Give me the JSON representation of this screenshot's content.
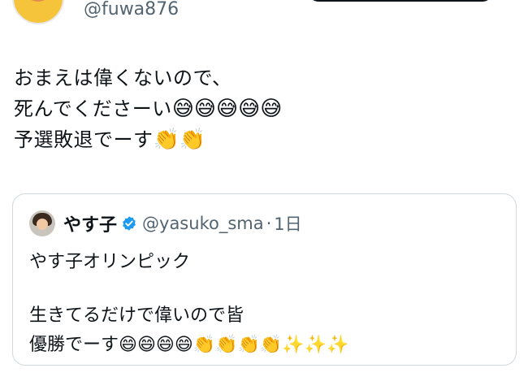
{
  "author": {
    "handle": "@fuwa876",
    "avatar_icon": "avatar-image"
  },
  "tweet": {
    "lines": [
      {
        "text": "おまえは偉くないので、",
        "emoji": ""
      },
      {
        "text": "死んでくださーい",
        "emoji": "😅😅😅😅😅"
      },
      {
        "text": "予選敗退でーす",
        "emoji": "👏👏"
      }
    ]
  },
  "quote": {
    "avatar_icon": "avatar-image",
    "name": "やす子",
    "verified_icon": "verified-badge-icon",
    "verified_color": "#1d9bf0",
    "handle": "@yasuko_sma",
    "separator": "·",
    "time": "1日",
    "lines": [
      {
        "text": "やす子オリンピック",
        "emoji": ""
      },
      {
        "text": "",
        "emoji": ""
      },
      {
        "text": "生きてるだけで偉いので皆",
        "emoji": ""
      },
      {
        "text": "優勝でーす",
        "emoji": "😄😄😄😄👏👏👏👏✨✨✨"
      }
    ]
  },
  "colors": {
    "text": "#0f1419",
    "secondary_text": "#536471",
    "border": "#cfd9de"
  }
}
